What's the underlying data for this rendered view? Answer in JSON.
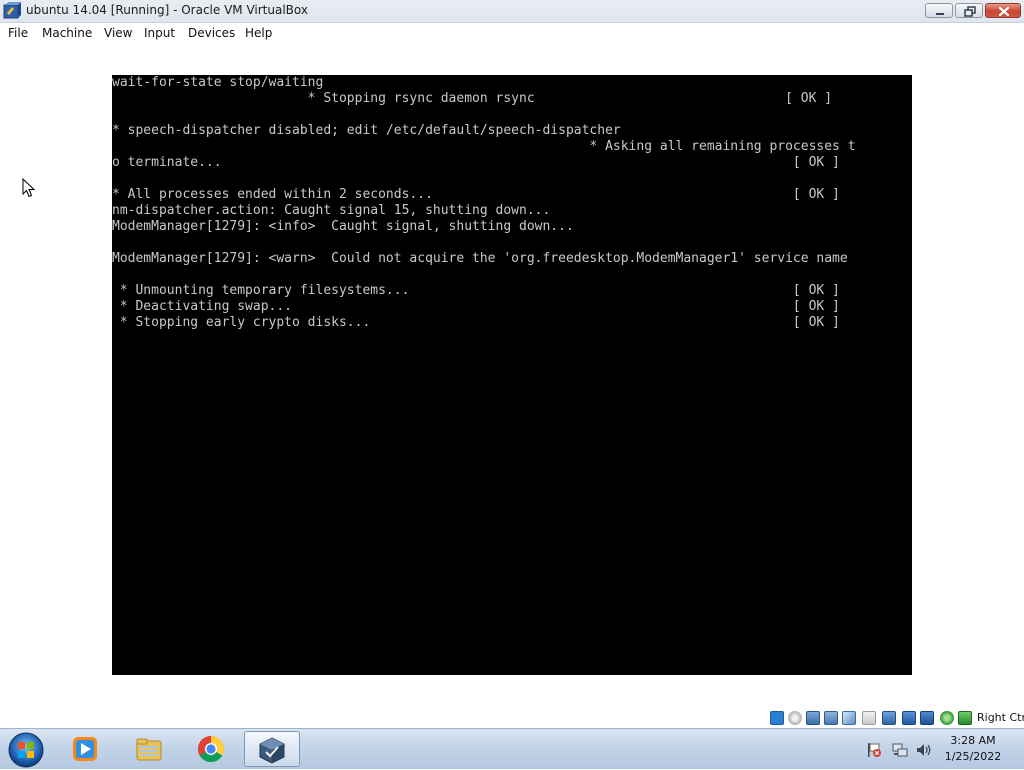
{
  "window": {
    "title": "ubuntu 14.04 [Running] - Oracle VM VirtualBox"
  },
  "menu": {
    "file": "File",
    "machine": "Machine",
    "view": "View",
    "input": "Input",
    "devices": "Devices",
    "help": "Help"
  },
  "console": {
    "lines": [
      "wait-for-state stop/waiting",
      "                         * Stopping rsync daemon rsync                                [ OK ]",
      "",
      "* speech-dispatcher disabled; edit /etc/default/speech-dispatcher",
      "                                                             * Asking all remaining processes t",
      "o terminate...                                                                         [ OK ]",
      "",
      "* All processes ended within 2 seconds...                                              [ OK ]",
      "nm-dispatcher.action: Caught signal 15, shutting down...",
      "ModemManager[1279]: <info>  Caught signal, shutting down...",
      "",
      "ModemManager[1279]: <warn>  Could not acquire the 'org.freedesktop.ModemManager1' service name",
      "",
      " * Unmounting temporary filesystems...                                                 [ OK ]",
      " * Deactivating swap...                                                                [ OK ]",
      " * Stopping early crypto disks...                                                      [ OK ]"
    ]
  },
  "statusbar": {
    "host_key": "Right Ctrl",
    "icons": [
      "hard-disk-icon",
      "optical-drive-icon",
      "audio-icon",
      "network-icon",
      "usb-icon",
      "shared-folders-icon",
      "display-icon",
      "video-capture-icon",
      "cpu-icon",
      "mouse-integration-icon",
      "keyboard-capture-icon"
    ]
  },
  "taskbar": {
    "apps": [
      "windows-media-player-icon",
      "windows-explorer-icon",
      "chrome-icon",
      "virtualbox-icon"
    ],
    "active_app": "virtualbox",
    "tray_icons": [
      "action-center-flag-icon",
      "network-icon",
      "volume-icon"
    ],
    "clock": {
      "time": "3:28 AM",
      "date": "1/25/2022"
    }
  },
  "colors": {
    "console_bg": "#000000",
    "console_fg": "#c9c9c9",
    "taskbar": "#c3d4e8",
    "close_button": "#c8452f"
  }
}
